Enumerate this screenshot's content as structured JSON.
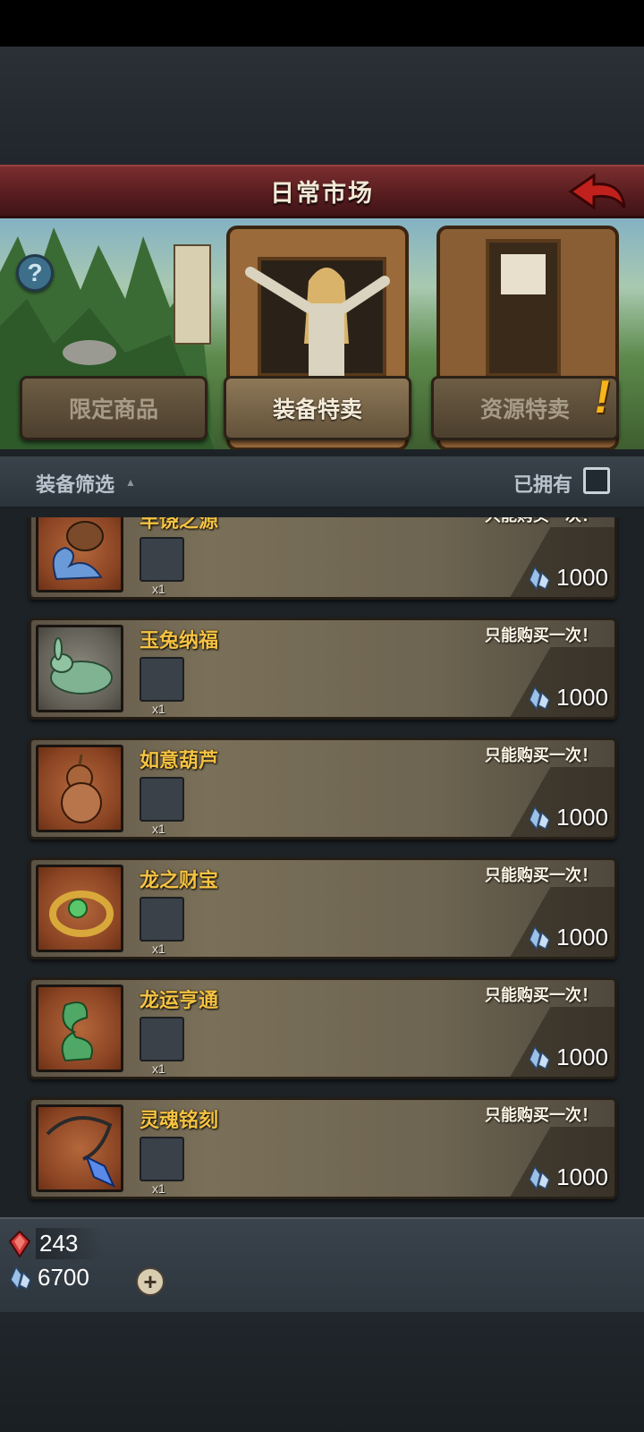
{
  "header": {
    "title": "日常市场"
  },
  "banner": {
    "help_label": "?",
    "tabs": [
      {
        "label": "限定商品",
        "active": false
      },
      {
        "label": "装备特卖",
        "active": true
      },
      {
        "label": "资源特卖",
        "active": false,
        "alert": "!"
      }
    ]
  },
  "filter": {
    "label": "装备筛选",
    "caret": "▲",
    "owned_label": "已拥有"
  },
  "items": [
    {
      "name": "丰饶之源",
      "limit": "只能购买一次！",
      "qty": "x1",
      "price": "1000",
      "icon": "water-vase-icon"
    },
    {
      "name": "玉兔纳福",
      "limit": "只能购买一次！",
      "qty": "x1",
      "price": "1000",
      "icon": "jade-rabbit-icon"
    },
    {
      "name": "如意葫芦",
      "limit": "只能购买一次！",
      "qty": "x1",
      "price": "1000",
      "icon": "gourd-icon"
    },
    {
      "name": "龙之财宝",
      "limit": "只能购买一次！",
      "qty": "x1",
      "price": "1000",
      "icon": "dragon-ring-icon"
    },
    {
      "name": "龙运亨通",
      "limit": "只能购买一次！",
      "qty": "x1",
      "price": "1000",
      "icon": "jade-dragon-icon"
    },
    {
      "name": "灵魂铭刻",
      "limit": "只能购买一次！",
      "qty": "x1",
      "price": "1000",
      "icon": "crystal-pendant-icon"
    }
  ],
  "currency": {
    "gems": "243",
    "crystals": "6700",
    "add_label": "+"
  },
  "colors": {
    "title_bar": "#561c1f",
    "item_name": "#f5c343",
    "panel": "#2c343b"
  }
}
